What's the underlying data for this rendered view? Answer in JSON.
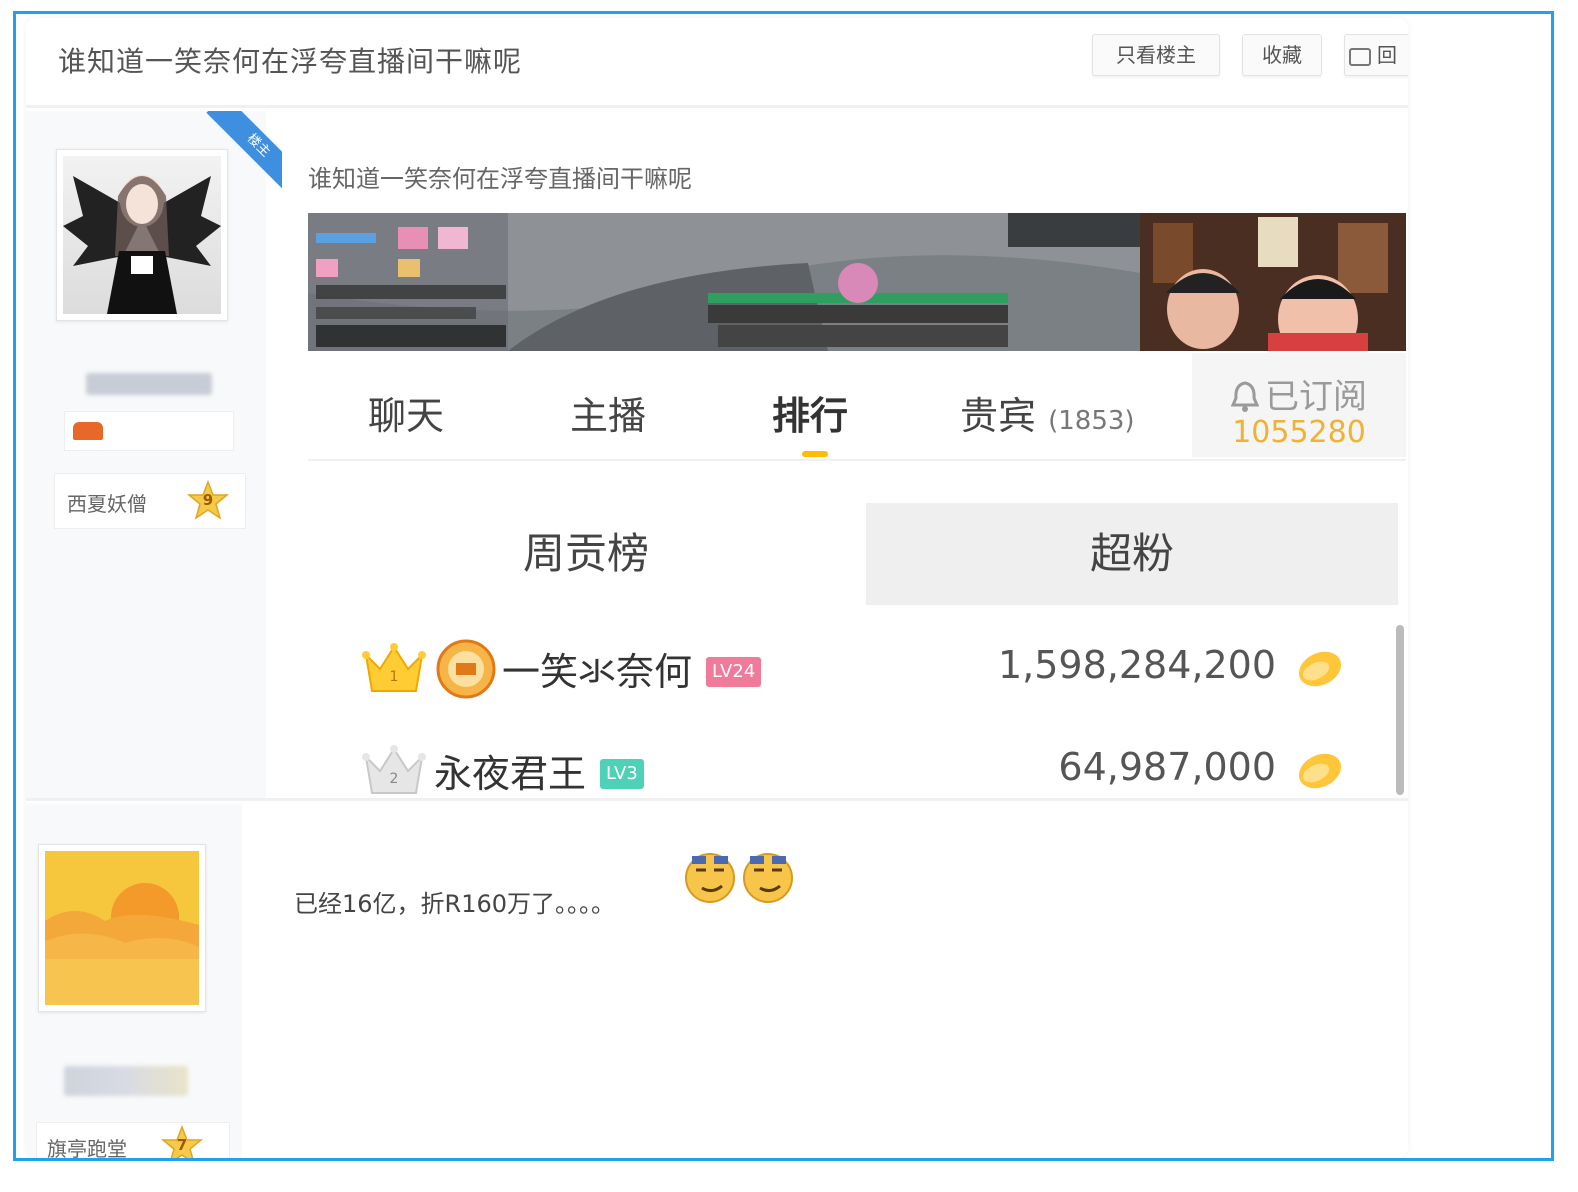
{
  "thread": {
    "title": "谁知道一笑奈何在浮夸直播间干嘛呢",
    "buttons": [
      "只看楼主",
      "收藏",
      "回"
    ]
  },
  "post1": {
    "author_badge": "楼主",
    "author_level_name": "西夏妖僧",
    "author_level": "9",
    "title": "谁知道一笑奈何在浮夸直播间干嘛呢",
    "tabs": [
      {
        "label": "聊天"
      },
      {
        "label": "主播"
      },
      {
        "label": "排行"
      },
      {
        "label": "贵宾",
        "count": "(1853)"
      }
    ],
    "subscribe": {
      "label": "已订阅",
      "count": "1055280"
    },
    "rank_tabs": [
      "周贡榜",
      "超粉"
    ],
    "ranking": [
      {
        "rank": "1",
        "name": "一笑氺奈何",
        "level": "LV24",
        "value": "1,598,284,200"
      },
      {
        "rank": "2",
        "name": "永夜君王",
        "level": "LV3",
        "value": "64,987,000"
      }
    ]
  },
  "post2": {
    "author_level_name": "旗亭跑堂",
    "author_level": "7",
    "text": "已经16亿，折R160万了。。。。"
  },
  "colors": {
    "frame": "#1ea1ee",
    "badge": "#3f8fe0",
    "accent": "#ffbc00",
    "lv24": "#f07a9a",
    "lv3": "#4fd1b8",
    "subscribe_count": "#f0b230"
  }
}
